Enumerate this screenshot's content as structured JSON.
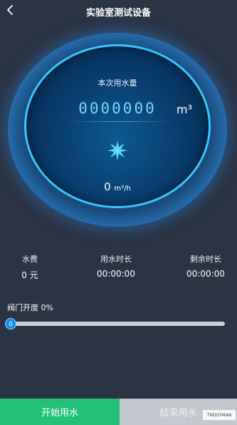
{
  "header": {
    "title": "实验室测试设备"
  },
  "gauge": {
    "label": "本次用水量",
    "digits": "0000000",
    "unit": "m³",
    "flow_value": "0",
    "flow_unit": "m³/h",
    "icon": "fan-icon"
  },
  "stats": {
    "fee_label": "水费",
    "fee_value": "0 元",
    "used_label": "用水时长",
    "used_value": "00:00:00",
    "remain_label": "剩余时长",
    "remain_value": "00:00:00"
  },
  "valve": {
    "label": "阀门开度 0%",
    "percent": 0,
    "thumb_text": "0"
  },
  "buttons": {
    "start": "开始用水",
    "stop": "结束用水"
  },
  "watermark": "TNDOYMAN",
  "colors": {
    "background": "#2a3445",
    "accent": "#39c6ff",
    "start": "#23c178",
    "stop": "#c4c8cf"
  }
}
